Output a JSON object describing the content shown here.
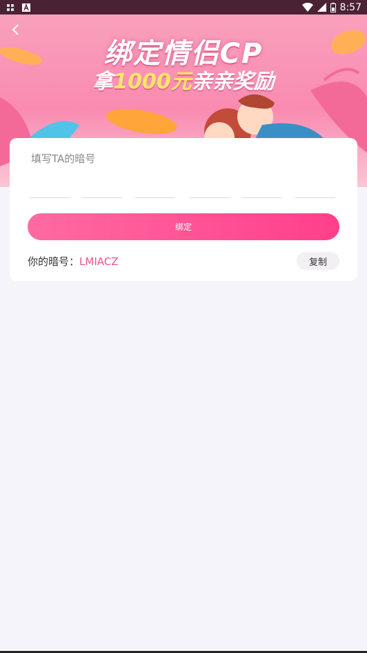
{
  "status_bar": {
    "time": "8:57",
    "icons": [
      "app-notification-icon",
      "a-notification-icon",
      "wifi-icon",
      "signal-icon",
      "battery-icon"
    ]
  },
  "banner": {
    "title": "绑定情侣CP",
    "subtitle_prefix": "拿",
    "subtitle_amount": "1000元",
    "subtitle_suffix": "亲亲奖励"
  },
  "form": {
    "label": "填写TA的暗号",
    "code_slots": 6,
    "bind_label": "绑定",
    "my_code_label": "你的暗号：",
    "my_code_value": "LMIACZ",
    "copy_label": "复制"
  },
  "colors": {
    "accent": "#ff4f92",
    "code_value": "#f0508b",
    "status_bar": "#4a2233"
  }
}
